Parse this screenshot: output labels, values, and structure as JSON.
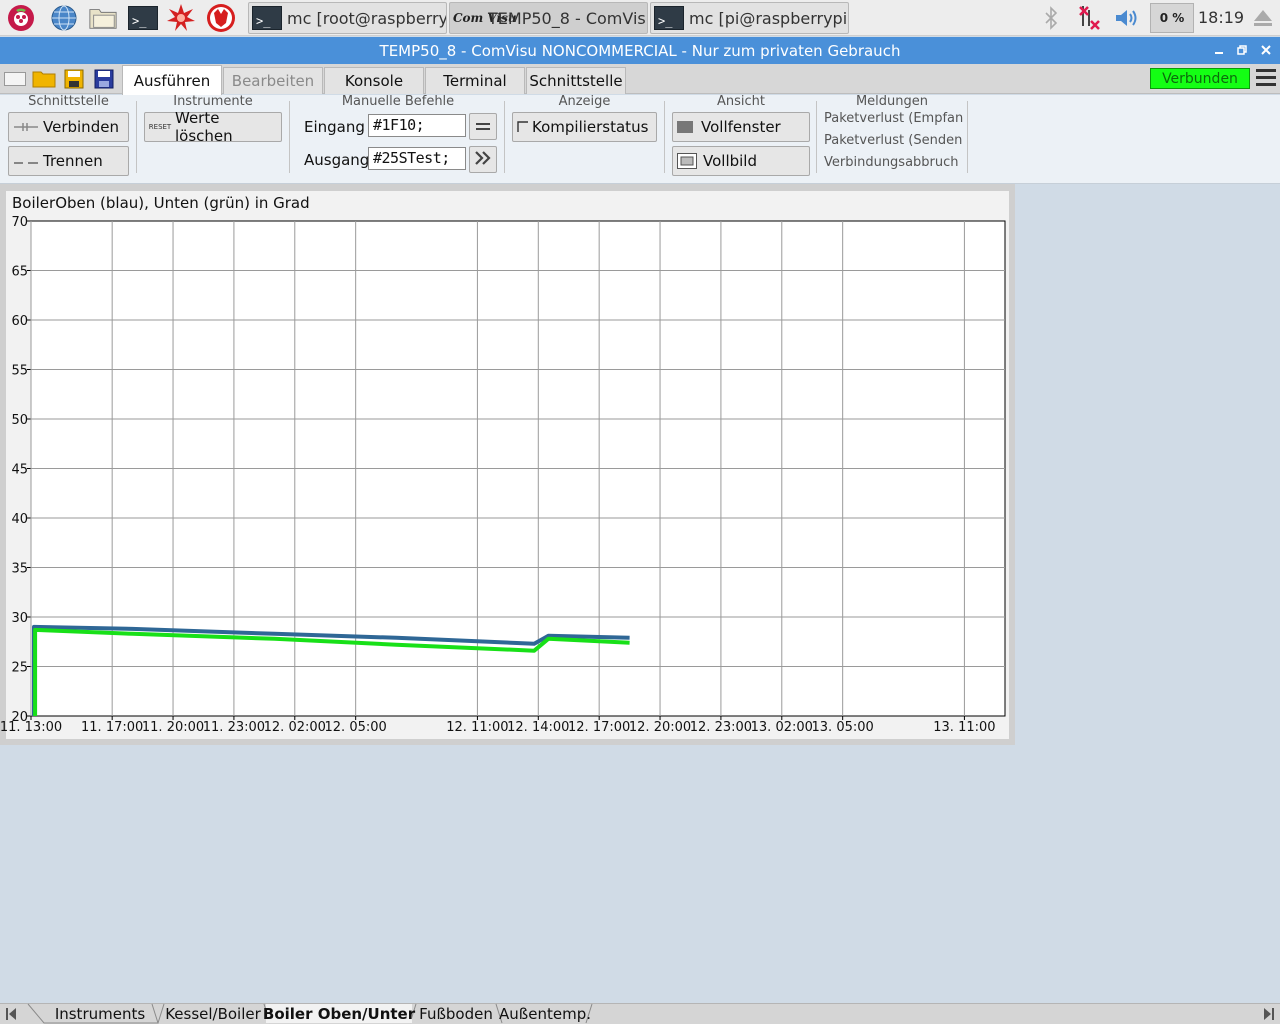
{
  "taskbar": {
    "launchers": [
      "raspberry-menu-icon",
      "web-browser-icon",
      "file-manager-icon",
      "terminal-icon",
      "math-icon",
      "wolfram-icon"
    ],
    "windows": [
      {
        "label": "mc [root@raspberryp...",
        "icon": "terminal-icon",
        "active": false
      },
      {
        "label": "TEMP50_8 - ComVis...",
        "icon": "comvisu-icon",
        "icon_text": "Com Visu",
        "active": true
      },
      {
        "label": "mc [pi@raspberrypi]:~",
        "icon": "terminal-icon",
        "active": false
      }
    ],
    "terminal_glyph": ">_",
    "cpu": "0 %",
    "clock": "18:19"
  },
  "window": {
    "title": "TEMP50_8 - ComVisu NONCOMMERCIAL - Nur zum privaten Gebrauch"
  },
  "menubar": {
    "tabs": [
      {
        "label": "Ausführen",
        "active": true,
        "disabled": false
      },
      {
        "label": "Bearbeiten",
        "active": false,
        "disabled": true
      },
      {
        "label": "Konsole",
        "active": false,
        "disabled": false
      },
      {
        "label": "Terminal",
        "active": false,
        "disabled": false
      },
      {
        "label": "Schnittstelle",
        "active": false,
        "disabled": false
      }
    ],
    "status": "Verbunden",
    "status_color": "#14ff14"
  },
  "ribbon": {
    "schnittstelle": {
      "label": "Schnittstelle",
      "connect": "Verbinden",
      "disconnect": "Trennen"
    },
    "instrumente": {
      "label": "Instrumente",
      "reset_icon_text": "RESET",
      "clear": "Werte löschen"
    },
    "manuelle": {
      "label": "Manuelle Befehle",
      "input_label": "Eingang",
      "input_value": "#1F10;",
      "output_label": "Ausgang",
      "output_value": "#25STest;"
    },
    "anzeige": {
      "label": "Anzeige",
      "compile": "Kompilierstatus"
    },
    "ansicht": {
      "label": "Ansicht",
      "window": "Vollfenster",
      "fullscreen": "Vollbild"
    },
    "meldungen": {
      "label": "Meldungen",
      "items": [
        "Paketverlust (Empfan",
        "Paketverlust (Senden",
        "Verbindungsabbruch"
      ]
    }
  },
  "chart_data": {
    "type": "line",
    "title": "BoilerOben (blau), Unten (grün) in Grad",
    "ylim": [
      20,
      70
    ],
    "yticks": [
      20,
      25,
      30,
      35,
      40,
      45,
      50,
      55,
      60,
      65,
      70
    ],
    "xlim": [
      0,
      48
    ],
    "xticks": [
      {
        "x": 0,
        "label": "11. 13:00"
      },
      {
        "x": 4,
        "label": "11. 17:00"
      },
      {
        "x": 7,
        "label": "11. 20:00"
      },
      {
        "x": 10,
        "label": "11. 23:00"
      },
      {
        "x": 13,
        "label": "12. 02:00"
      },
      {
        "x": 16,
        "label": "12. 05:00"
      },
      {
        "x": 22,
        "label": "12. 11:00"
      },
      {
        "x": 25,
        "label": "12. 14:00"
      },
      {
        "x": 28,
        "label": "12. 17:00"
      },
      {
        "x": 31,
        "label": "12. 20:00"
      },
      {
        "x": 34,
        "label": "12. 23:00"
      },
      {
        "x": 37,
        "label": "13. 02:00"
      },
      {
        "x": 40,
        "label": "13. 05:00"
      },
      {
        "x": 46,
        "label": "13. 11:00"
      }
    ],
    "grid": true,
    "series": [
      {
        "color": "#2f6796",
        "x": [
          0.15,
          0.15,
          5,
          12,
          18,
          24.8,
          25.5,
          29.5
        ],
        "y": [
          20,
          29.0,
          28.8,
          28.3,
          27.9,
          27.3,
          28.1,
          27.9
        ]
      },
      {
        "color": "#18e018",
        "x": [
          0.2,
          0.2,
          5,
          12,
          18,
          24.8,
          25.5,
          29.5
        ],
        "y": [
          20,
          28.7,
          28.3,
          27.8,
          27.2,
          26.6,
          27.8,
          27.4
        ]
      }
    ]
  },
  "sheets": {
    "tabs": [
      {
        "label": "Instruments",
        "active": false
      },
      {
        "label": "Kessel/Boiler",
        "active": false
      },
      {
        "label": "Boiler Oben/Unter",
        "active": true
      },
      {
        "label": "Fußboden",
        "active": false
      },
      {
        "label": "Außentemp.",
        "active": false
      }
    ]
  }
}
